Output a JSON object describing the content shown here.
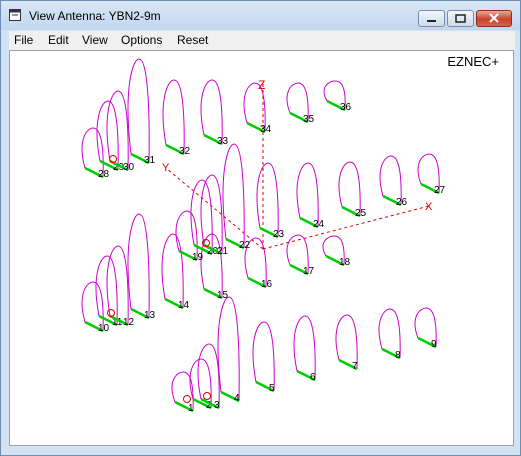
{
  "window": {
    "title": "View Antenna: YBN2-9m"
  },
  "menu": [
    "File",
    "Edit",
    "View",
    "Options",
    "Reset"
  ],
  "canvas": {
    "brand": "EZNEC+",
    "axis_labels": {
      "z": "Z",
      "y": "Y",
      "x": "X"
    },
    "element_numbers": [
      "1",
      "2",
      "3",
      "4",
      "5",
      "6",
      "7",
      "8",
      "9",
      "10",
      "11",
      "12",
      "13",
      "14",
      "15",
      "16",
      "17",
      "18",
      "19",
      "20",
      "21",
      "22",
      "23",
      "24",
      "25",
      "26",
      "27",
      "28",
      "29",
      "30",
      "31",
      "32",
      "33",
      "34",
      "35",
      "36"
    ],
    "colors": {
      "pattern": "#cc00cc",
      "element": "#00cc00",
      "axis": "#dd0000"
    }
  }
}
